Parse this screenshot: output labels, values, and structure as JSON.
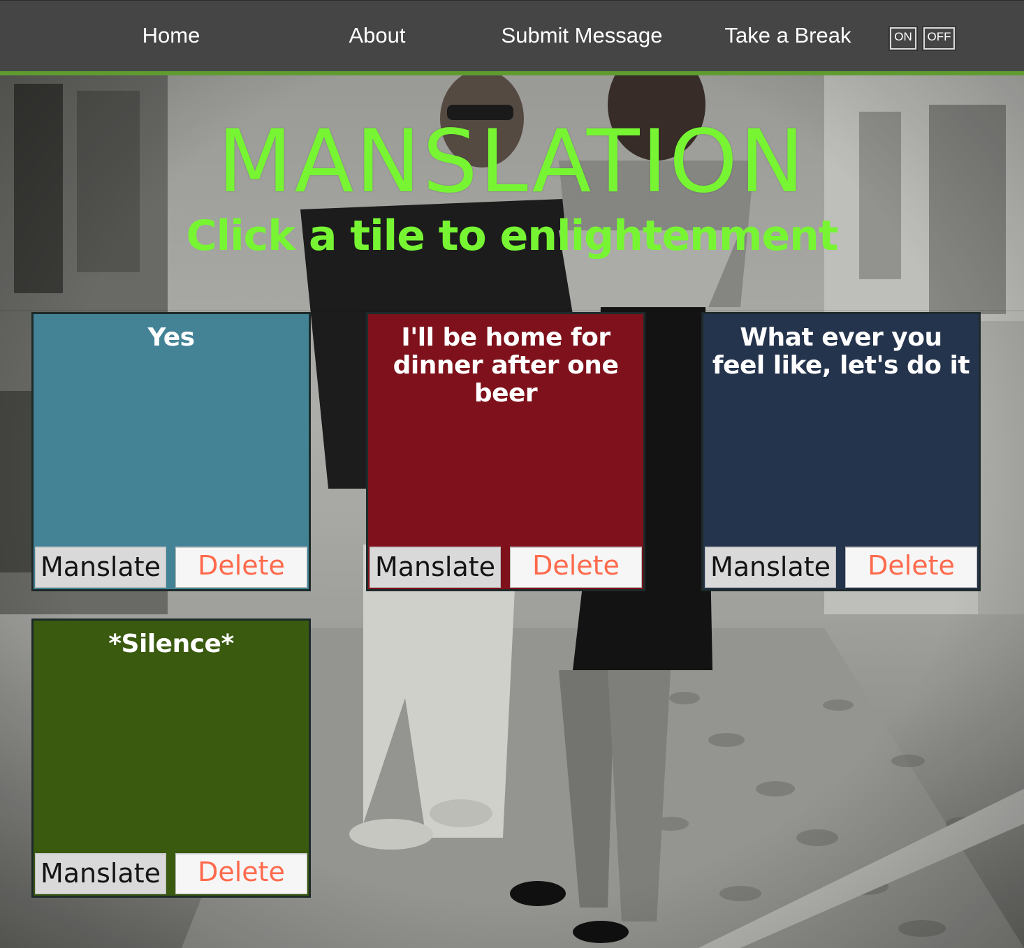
{
  "nav": {
    "links": [
      {
        "label": "Home"
      },
      {
        "label": "About"
      },
      {
        "label": "Submit Message"
      },
      {
        "label": "Take a Break"
      }
    ],
    "toggle_on": "ON",
    "toggle_off": "OFF",
    "accent_color": "#5f9c30"
  },
  "hero": {
    "title": "MANSLATION",
    "subtitle": "Click a tile to enlightenment",
    "text_color": "#77f533"
  },
  "tiles": [
    {
      "text": "Yes",
      "color": "#448396",
      "manslate_label": "Manslate",
      "delete_label": "Delete"
    },
    {
      "text": "I'll be home for dinner after one beer",
      "color": "#7e111b",
      "manslate_label": "Manslate",
      "delete_label": "Delete"
    },
    {
      "text": "What ever you feel like, let's do it",
      "color": "#25344d",
      "manslate_label": "Manslate",
      "delete_label": "Delete"
    },
    {
      "text": "*Silence*",
      "color": "#3a5a10",
      "manslate_label": "Manslate",
      "delete_label": "Delete"
    }
  ]
}
